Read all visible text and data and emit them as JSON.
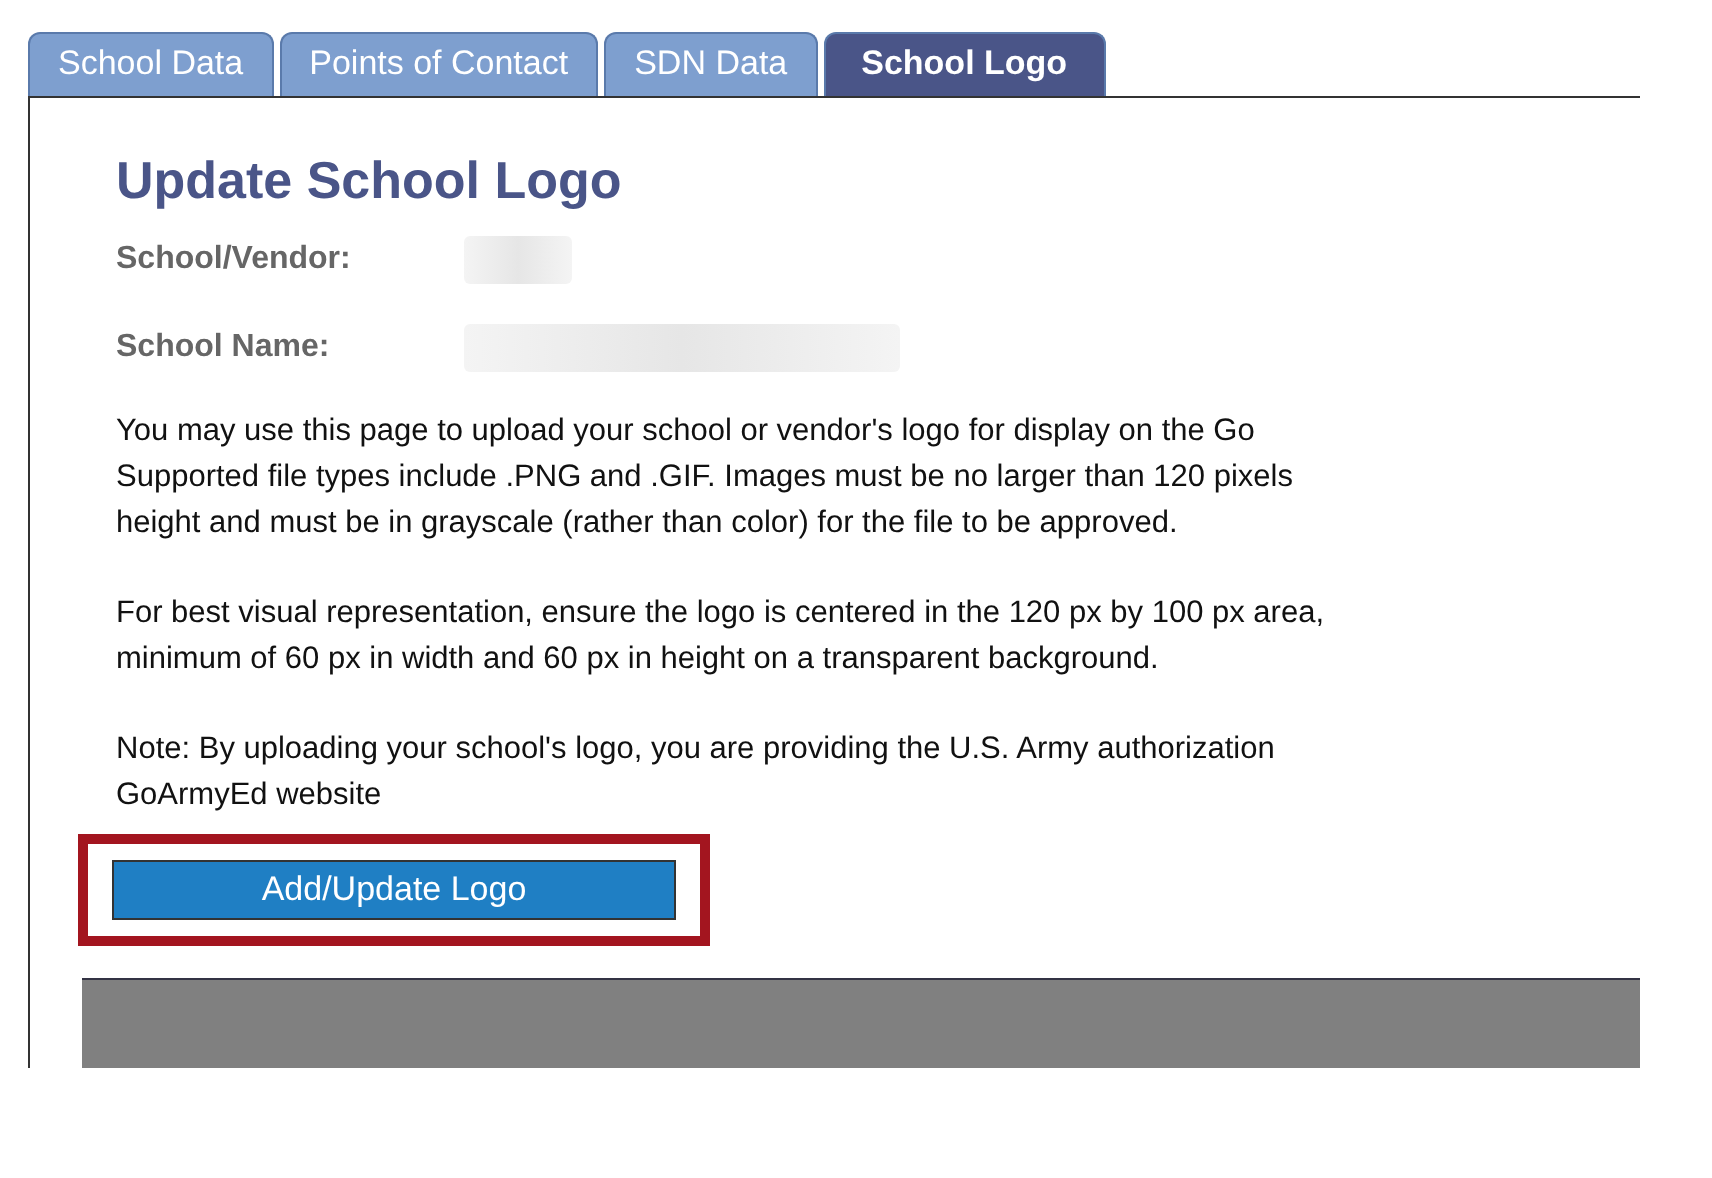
{
  "tabs": [
    {
      "label": "School Data",
      "selected": false
    },
    {
      "label": "Points of Contact",
      "selected": false
    },
    {
      "label": "SDN Data",
      "selected": false
    },
    {
      "label": "School Logo",
      "selected": true
    }
  ],
  "heading": "Update School Logo",
  "fields": [
    {
      "label": "School/Vendor:",
      "redacted": true
    },
    {
      "label": "School Name:",
      "redacted": true
    }
  ],
  "paragraphs": [
    {
      "lines": [
        "You may use this page to upload your school or vendor's logo for display on the Go",
        "Supported file types include .PNG and .GIF. Images must be no larger than 120 pixels",
        "height and must be in grayscale (rather than color) for the file to be approved."
      ]
    },
    {
      "lines": [
        "For best visual representation, ensure the logo is centered in the 120 px by 100 px area,",
        "minimum of 60 px in width and 60 px in height on a transparent background."
      ]
    },
    {
      "lines": [
        "Note: By uploading your school's logo, you are providing the U.S. Army authorization",
        "GoArmyEd website"
      ]
    }
  ],
  "button": {
    "label": "Add/Update Logo",
    "highlighted": true
  }
}
